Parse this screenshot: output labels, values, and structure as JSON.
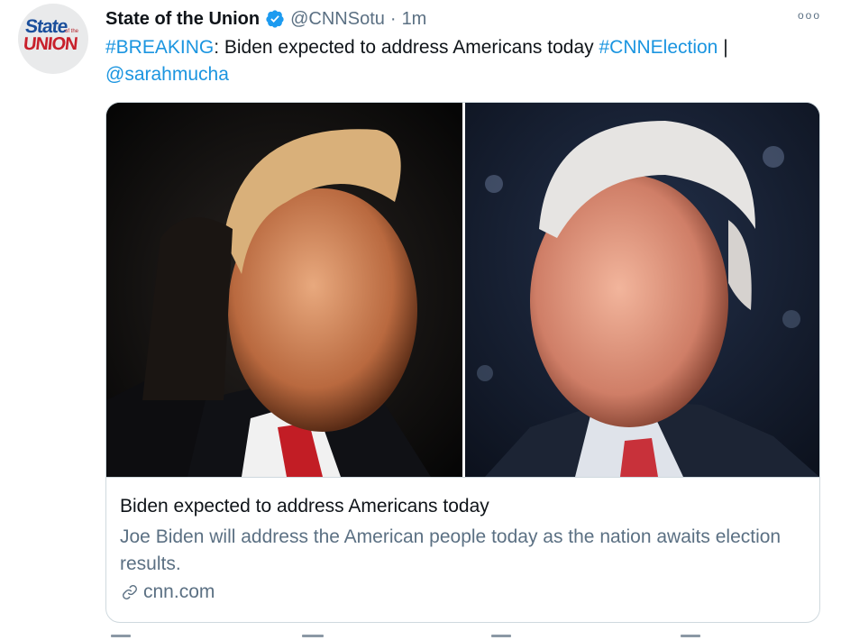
{
  "account": {
    "avatar_line1": "State",
    "avatar_small": "of the",
    "avatar_line2": "UNION",
    "display_name": "State of the Union",
    "handle": "@CNNSotu",
    "separator": "·",
    "timestamp": "1m",
    "verified_icon": "verified-badge-icon"
  },
  "more_icon": "ooo",
  "tweet": {
    "hashtag1": "#BREAKING",
    "text_part": ": Biden expected to address Americans today ",
    "hashtag2": "#CNNElection",
    "pipe": " |",
    "mention": "@sarahmucha"
  },
  "card": {
    "image_description_icon": "split-photo",
    "title": "Biden expected to address Americans today",
    "description": "Joe Biden will address the American people today as the nation awaits election results.",
    "domain": "cnn.com",
    "link_icon": "link-icon"
  },
  "colors": {
    "link": "#1b95e0",
    "secondary_text": "#5b7083",
    "verified": "#1d9bf0",
    "border": "#cfd9de"
  }
}
